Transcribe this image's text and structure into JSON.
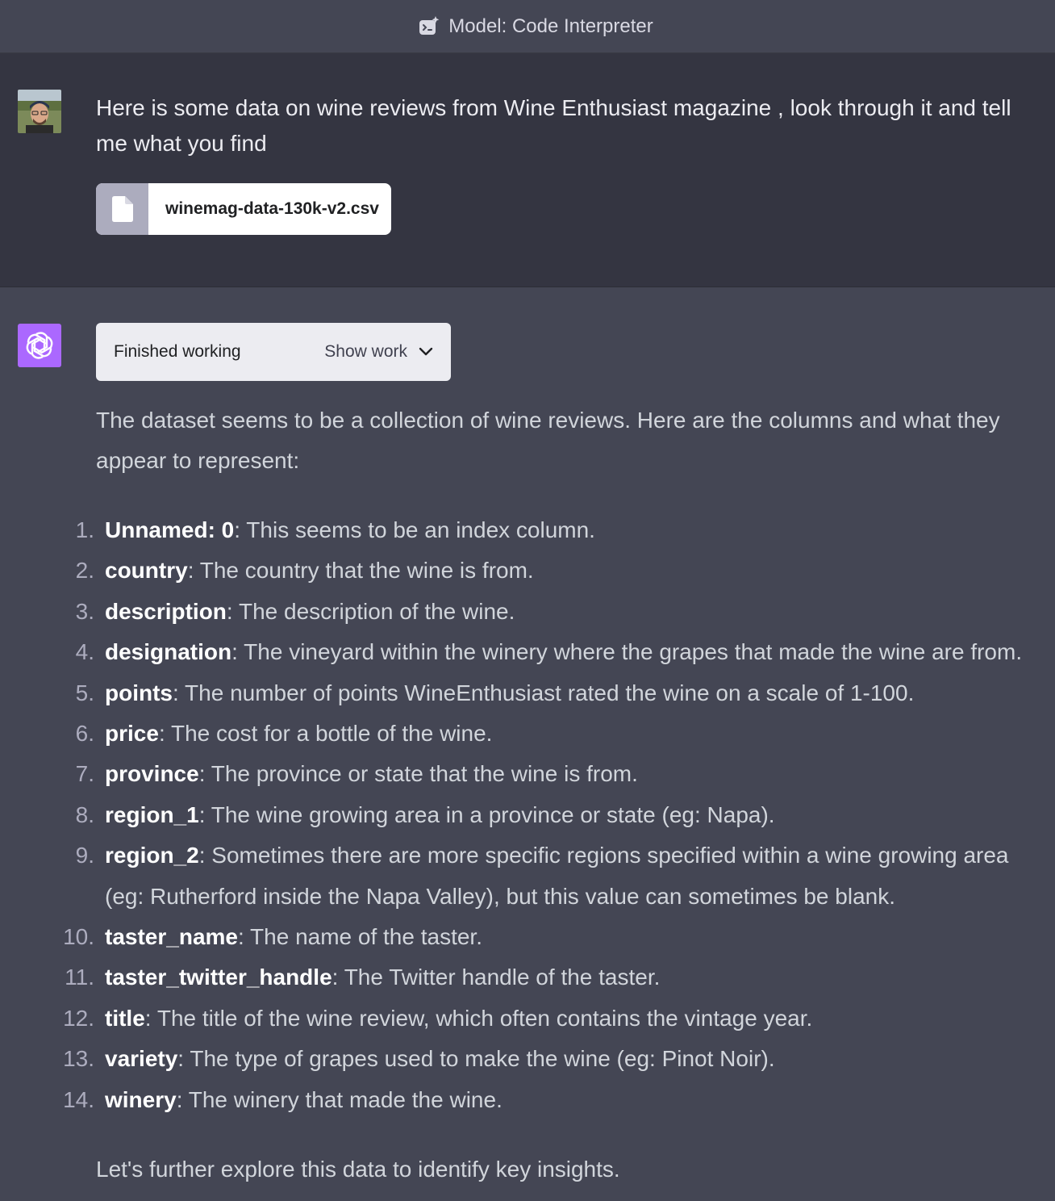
{
  "header": {
    "model_label": "Model: Code Interpreter",
    "icon": "code-interpreter-icon"
  },
  "user_message": {
    "avatar": "user-avatar-photo",
    "text": "Here is some data on wine reviews from Wine Enthusiast magazine , look through it and tell me what you find",
    "attachment": {
      "icon": "file-icon",
      "filename": "winemag-data-130k-v2.csv"
    }
  },
  "assistant_message": {
    "avatar": "openai-logo",
    "work_status": "Finished working",
    "show_work_label": "Show work",
    "intro": "The dataset seems to be a collection of wine reviews. Here are the columns and what they appear to represent:",
    "columns": [
      {
        "num": "1.",
        "key": "Unnamed: 0",
        "desc": ": This seems to be an index column."
      },
      {
        "num": "2.",
        "key": "country",
        "desc": ": The country that the wine is from."
      },
      {
        "num": "3.",
        "key": "description",
        "desc": ": The description of the wine."
      },
      {
        "num": "4.",
        "key": "designation",
        "desc": ": The vineyard within the winery where the grapes that made the wine are from."
      },
      {
        "num": "5.",
        "key": "points",
        "desc": ": The number of points WineEnthusiast rated the wine on a scale of 1-100."
      },
      {
        "num": "6.",
        "key": "price",
        "desc": ": The cost for a bottle of the wine."
      },
      {
        "num": "7.",
        "key": "province",
        "desc": ": The province or state that the wine is from."
      },
      {
        "num": "8.",
        "key": "region_1",
        "desc": ": The wine growing area in a province or state (eg: Napa)."
      },
      {
        "num": "9.",
        "key": "region_2",
        "desc": ": Sometimes there are more specific regions specified within a wine growing area (eg: Rutherford inside the Napa Valley), but this value can sometimes be blank."
      },
      {
        "num": "10.",
        "key": "taster_name",
        "desc": ": The name of the taster."
      },
      {
        "num": "11.",
        "key": "taster_twitter_handle",
        "desc": ": The Twitter handle of the taster."
      },
      {
        "num": "12.",
        "key": "title",
        "desc": ": The title of the wine review, which often contains the vintage year."
      },
      {
        "num": "13.",
        "key": "variety",
        "desc": ": The type of grapes used to make the wine (eg: Pinot Noir)."
      },
      {
        "num": "14.",
        "key": "winery",
        "desc": ": The winery that made the wine."
      }
    ],
    "outro": "Let's further explore this data to identify key insights."
  },
  "colors": {
    "page_bg": "#444654",
    "user_bg": "#343541",
    "accent": "#ab68ff",
    "text": "#d1d5db"
  }
}
